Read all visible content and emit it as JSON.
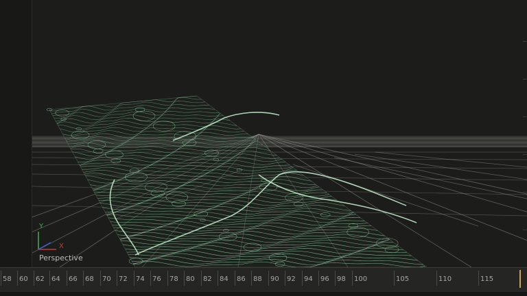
{
  "viewport": {
    "view_name": "Perspective",
    "axis_labels": {
      "y": "Y",
      "x": "X"
    },
    "colors": {
      "background": "#1c1d1a",
      "grid": "#9b9c96",
      "terrain": "#8fc4a0",
      "axis_y": "#3fae5a",
      "axis_x": "#c23b3b",
      "axis_z": "#3c5fd6"
    }
  },
  "timeline": {
    "ticks": [
      "58",
      "60",
      "62",
      "64",
      "66",
      "68",
      "70",
      "72",
      "74",
      "76",
      "78",
      "80",
      "82",
      "84",
      "86",
      "88",
      "90",
      "92",
      "94",
      "96",
      "98",
      "100",
      "105",
      "110",
      "115"
    ],
    "playhead_color": "#d0a24a"
  }
}
